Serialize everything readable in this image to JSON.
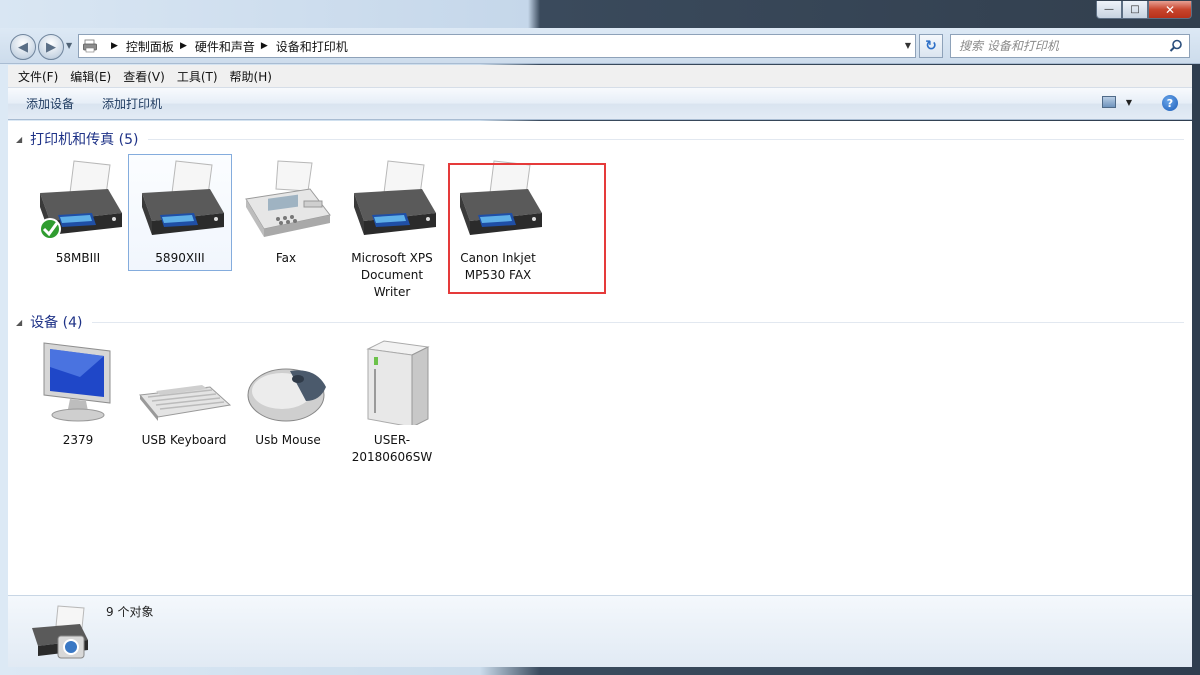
{
  "window": {
    "controls": {
      "minimize": "—",
      "maximize": "□",
      "close": "✕"
    }
  },
  "address": {
    "breadcrumbs": [
      "控制面板",
      "硬件和声音",
      "设备和打印机"
    ],
    "search_placeholder": "搜索 设备和打印机"
  },
  "menu": [
    "文件(F)",
    "编辑(E)",
    "查看(V)",
    "工具(T)",
    "帮助(H)"
  ],
  "commands": {
    "add_device": "添加设备",
    "add_printer": "添加打印机"
  },
  "groups": [
    {
      "title": "打印机和传真 (5)",
      "items": [
        {
          "label": "58MBIII",
          "icon": "printer-default-icon",
          "default": true
        },
        {
          "label": "5890XIII",
          "icon": "printer-icon",
          "selected": true
        },
        {
          "label": "Fax",
          "icon": "fax-icon"
        },
        {
          "label": "Microsoft XPS Document Writer",
          "icon": "printer-icon"
        },
        {
          "label": "Canon Inkjet MP530 FAX",
          "icon": "printer-icon",
          "highlighted": true
        }
      ]
    },
    {
      "title": "设备 (4)",
      "items": [
        {
          "label": "2379",
          "icon": "monitor-icon"
        },
        {
          "label": "USB Keyboard",
          "icon": "keyboard-icon"
        },
        {
          "label": "Usb Mouse",
          "icon": "mouse-icon"
        },
        {
          "label": "USER-20180606SW",
          "icon": "computer-tower-icon"
        }
      ]
    }
  ],
  "details": {
    "count": "9 个对象"
  },
  "colors": {
    "highlight_border": "#e53a3a",
    "group_title": "#1e3287",
    "selection_border": "#84acdd"
  }
}
